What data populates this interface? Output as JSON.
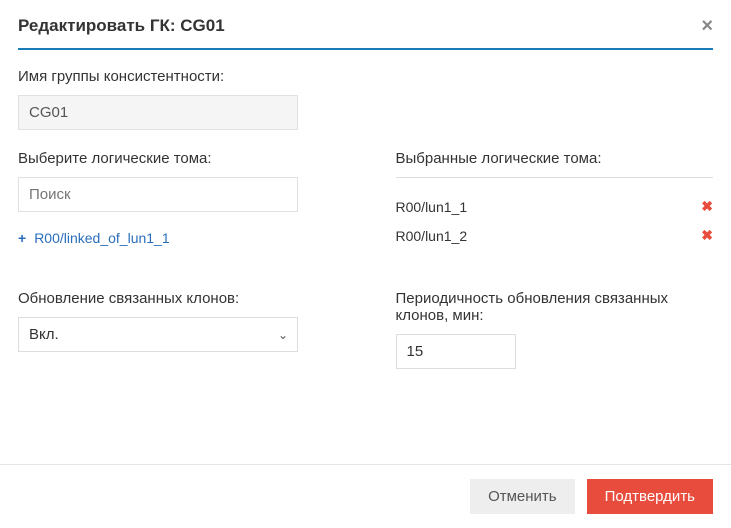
{
  "dialog": {
    "title": "Редактировать ГК: CG01"
  },
  "name_field": {
    "label": "Имя группы консистентности:",
    "value": "CG01"
  },
  "available": {
    "label": "Выберите логические тома:",
    "search_placeholder": "Поиск",
    "items": [
      {
        "label": "R00/linked_of_lun1_1"
      }
    ]
  },
  "selected": {
    "label": "Выбранные логические тома:",
    "items": [
      {
        "label": "R00/lun1_1"
      },
      {
        "label": "R00/lun1_2"
      }
    ]
  },
  "clone_update": {
    "label": "Обновление связанных клонов:",
    "value": "Вкл."
  },
  "period": {
    "label": "Периодичность обновления связанных клонов, мин:",
    "value": "15"
  },
  "buttons": {
    "cancel": "Отменить",
    "confirm": "Подтвердить"
  }
}
